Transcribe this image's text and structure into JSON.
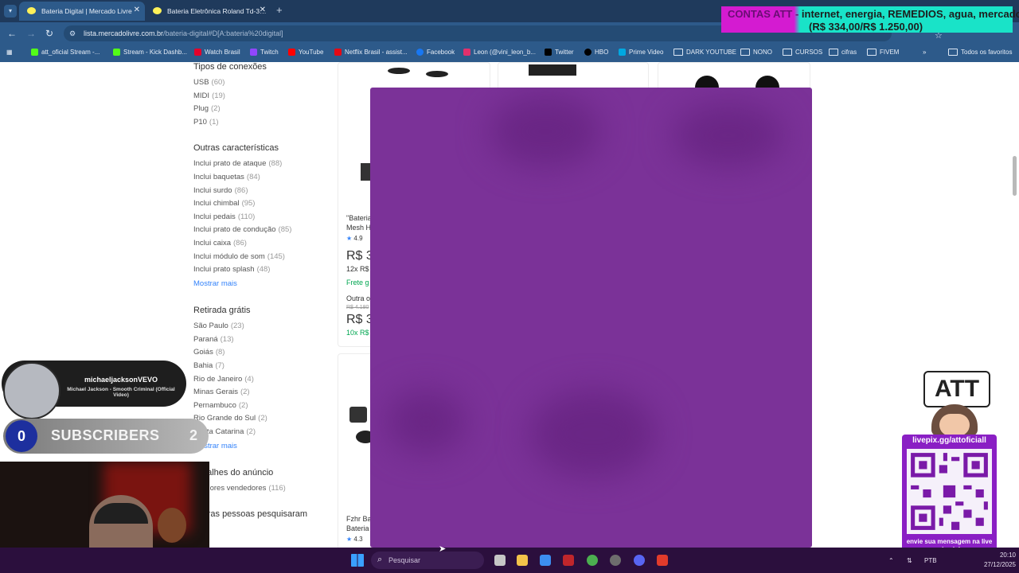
{
  "browser": {
    "tabs": [
      {
        "title": "Bateria Digital | Mercado Livre",
        "active": true
      },
      {
        "title": "Bateria Eletrônica Roland Td-3…",
        "active": false
      }
    ],
    "url_host": "lista.mercadolivre.com.br",
    "url_path": "/bateria-digital#D[A:bateria%20digital]",
    "bookmarks": [
      "att_oficial Stream -...",
      "Stream - Kick Dashb...",
      "Watch Brasil",
      "Twitch",
      "YouTube",
      "Netflix Brasil - assist...",
      "Facebook",
      "Leon (@vini_leon_b...",
      "Twitter",
      "HBO",
      "Prime Video",
      "DARK YOUTUBE",
      "NONO",
      "CURSOS",
      "cifras",
      "FIVEM"
    ],
    "all_bookmarks": "Todos os favoritos"
  },
  "banner": {
    "line1_prefix": "CONTAS ATT - ",
    "line1_rest": "internet, energia, REMEDIOS, agua, mercado!",
    "line2": "(R$ 334,00/R$ 1.250,00)"
  },
  "sidebar": {
    "connections_title": "Tipos de conexões",
    "connections": [
      {
        "label": "USB",
        "count": "(60)"
      },
      {
        "label": "MIDI",
        "count": "(19)"
      },
      {
        "label": "Plug",
        "count": "(2)"
      },
      {
        "label": "P10",
        "count": "(1)"
      }
    ],
    "other_title": "Outras características",
    "other": [
      {
        "label": "Inclui prato de ataque",
        "count": "(88)"
      },
      {
        "label": "Inclui baquetas",
        "count": "(84)"
      },
      {
        "label": "Inclui surdo",
        "count": "(86)"
      },
      {
        "label": "Inclui chimbal",
        "count": "(95)"
      },
      {
        "label": "Inclui pedais",
        "count": "(110)"
      },
      {
        "label": "Inclui prato de condução",
        "count": "(85)"
      },
      {
        "label": "Inclui caixa",
        "count": "(86)"
      },
      {
        "label": "Inclui módulo de som",
        "count": "(145)"
      },
      {
        "label": "Inclui prato splash",
        "count": "(48)"
      }
    ],
    "show_more": "Mostrar mais",
    "pickup_title": "Retirada grátis",
    "pickup": [
      {
        "label": "São Paulo",
        "count": "(23)"
      },
      {
        "label": "Paraná",
        "count": "(13)"
      },
      {
        "label": "Goiás",
        "count": "(8)"
      },
      {
        "label": "Bahia",
        "count": "(7)"
      },
      {
        "label": "Rio de Janeiro",
        "count": "(4)"
      },
      {
        "label": "Minas Gerais",
        "count": "(2)"
      },
      {
        "label": "Pernambuco",
        "count": "(2)"
      },
      {
        "label": "Rio Grande do Sul",
        "count": "(2)"
      },
      {
        "label": "Santa Catarina",
        "count": "(2)"
      }
    ],
    "show_more2": "Mostrar mais",
    "details_title": "Detalhes do anúncio",
    "details_item": {
      "label": "Melhores vendedores",
      "count": "(116)"
    },
    "others_searched": "Outras pessoas pesquisaram"
  },
  "cards": {
    "card1_title": "\"Bateria",
    "card1_sub": "Mesh H",
    "card1_rating": "4.9",
    "card1_price": "R$ 3",
    "card1_inst": "12x R$",
    "card1_ship": "Frete g",
    "card1_other": "Outra o",
    "card1_old": "R$ 4.180",
    "card1_price2": "R$ 3",
    "card1_inst2": "10x R$",
    "card2_title": "Fzhr Ba",
    "card2_sub": "Bateria",
    "card2_rating": "4.3"
  },
  "stream": {
    "artist": "michaeljacksonVEVO",
    "track": "Michael Jackson - Smooth Criminal (Official Video)",
    "subs_left": "0",
    "subs_label": "SUBSCRIBERS",
    "subs_right": "2",
    "att_sign": "ATT",
    "qr_title": "livepix.gg/attoficiall",
    "qr_caption": "envie sua mensagem na live via pix!"
  },
  "taskbar": {
    "search_placeholder": "Pesquisar",
    "lang": "PTB",
    "time": "20:10",
    "date": "27/12/2025"
  },
  "colors": {
    "overlay_purple": "#7b3298",
    "link_blue": "#3483fa",
    "free_ship_green": "#00a650"
  }
}
